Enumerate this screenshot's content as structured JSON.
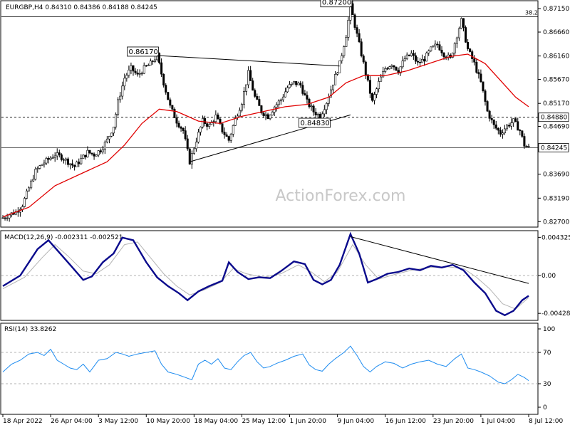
{
  "chart_data": [
    {
      "type": "candlestick",
      "title": "EURGBP,H4  0.84310 0.84386 0.84188 0.84245",
      "ylim": [
        0.826,
        0.873
      ],
      "y_ticks": [
        "0.87150",
        "0.86660",
        "0.86160",
        "0.85670",
        "0.85170",
        "0.84690",
        "0.84200",
        "0.83690",
        "0.83190",
        "0.82700"
      ],
      "x_ticks": [
        "18 Apr 2022",
        "26 Apr 04:00",
        "3 May 12:00",
        "10 May 20:00",
        "18 May 04:00",
        "25 May 12:00",
        "1 Jun 20:00",
        "9 Jun 04:00",
        "16 Jun 12:00",
        "23 Jun 20:00",
        "1 Jul 04:00",
        "8 Jul 12:00"
      ],
      "fib_level": {
        "label": "38.2",
        "value": 0.8698
      },
      "support_level": {
        "label": "0.84880",
        "value": 0.8488
      },
      "current_price": {
        "label": "0.84245",
        "value": 0.84245
      },
      "annotations": [
        {
          "text": "0.87200",
          "value": 0.872
        },
        {
          "text": "0.86170",
          "value": 0.8617
        },
        {
          "text": "0.84830",
          "value": 0.8483
        }
      ],
      "price_path": [
        [
          0,
          0.8278
        ],
        [
          3,
          0.8285
        ],
        [
          6,
          0.829
        ],
        [
          9,
          0.8305
        ],
        [
          12,
          0.834
        ],
        [
          15,
          0.8375
        ],
        [
          18,
          0.839
        ],
        [
          21,
          0.84
        ],
        [
          24,
          0.841
        ],
        [
          27,
          0.8405
        ],
        [
          30,
          0.8395
        ],
        [
          33,
          0.8385
        ],
        [
          36,
          0.84
        ],
        [
          39,
          0.8415
        ],
        [
          42,
          0.841
        ],
        [
          45,
          0.842
        ],
        [
          48,
          0.844
        ],
        [
          51,
          0.847
        ],
        [
          53,
          0.852
        ],
        [
          56,
          0.857
        ],
        [
          59,
          0.859
        ],
        [
          62,
          0.8575
        ],
        [
          65,
          0.859
        ],
        [
          68,
          0.86
        ],
        [
          71,
          0.8617
        ],
        [
          74,
          0.856
        ],
        [
          77,
          0.851
        ],
        [
          80,
          0.848
        ],
        [
          83,
          0.846
        ],
        [
          86,
          0.8395
        ],
        [
          89,
          0.844
        ],
        [
          92,
          0.848
        ],
        [
          95,
          0.847
        ],
        [
          98,
          0.849
        ],
        [
          101,
          0.846
        ],
        [
          104,
          0.844
        ],
        [
          107,
          0.8485
        ],
        [
          110,
          0.852
        ],
        [
          113,
          0.858
        ],
        [
          116,
          0.853
        ],
        [
          119,
          0.85
        ],
        [
          122,
          0.849
        ],
        [
          125,
          0.851
        ],
        [
          128,
          0.8525
        ],
        [
          131,
          0.855
        ],
        [
          134,
          0.856
        ],
        [
          137,
          0.8555
        ],
        [
          140,
          0.852
        ],
        [
          143,
          0.85
        ],
        [
          146,
          0.849
        ],
        [
          149,
          0.852
        ],
        [
          152,
          0.856
        ],
        [
          155,
          0.86
        ],
        [
          158,
          0.866
        ],
        [
          160,
          0.872
        ],
        [
          162,
          0.868
        ],
        [
          165,
          0.862
        ],
        [
          168,
          0.856
        ],
        [
          170,
          0.852
        ],
        [
          173,
          0.856
        ],
        [
          176,
          0.859
        ],
        [
          179,
          0.86
        ],
        [
          182,
          0.8585
        ],
        [
          185,
          0.861
        ],
        [
          188,
          0.862
        ],
        [
          191,
          0.86
        ],
        [
          194,
          0.861
        ],
        [
          197,
          0.863
        ],
        [
          200,
          0.864
        ],
        [
          203,
          0.862
        ],
        [
          206,
          0.861
        ],
        [
          209,
          0.866
        ],
        [
          211,
          0.869
        ],
        [
          214,
          0.863
        ],
        [
          217,
          0.86
        ],
        [
          220,
          0.856
        ],
        [
          223,
          0.85
        ],
        [
          226,
          0.847
        ],
        [
          229,
          0.8455
        ],
        [
          232,
          0.847
        ],
        [
          235,
          0.848
        ],
        [
          238,
          0.846
        ],
        [
          240,
          0.843
        ],
        [
          242,
          0.84245
        ]
      ],
      "ma_path": [
        [
          0,
          0.828
        ],
        [
          12,
          0.83
        ],
        [
          24,
          0.8345
        ],
        [
          36,
          0.837
        ],
        [
          48,
          0.8395
        ],
        [
          56,
          0.843
        ],
        [
          64,
          0.8475
        ],
        [
          72,
          0.8505
        ],
        [
          80,
          0.85
        ],
        [
          90,
          0.848
        ],
        [
          100,
          0.8475
        ],
        [
          110,
          0.849
        ],
        [
          120,
          0.85
        ],
        [
          130,
          0.851
        ],
        [
          140,
          0.8515
        ],
        [
          150,
          0.853
        ],
        [
          158,
          0.856
        ],
        [
          166,
          0.8575
        ],
        [
          176,
          0.8575
        ],
        [
          186,
          0.8585
        ],
        [
          196,
          0.86
        ],
        [
          206,
          0.8615
        ],
        [
          214,
          0.862
        ],
        [
          222,
          0.86
        ],
        [
          230,
          0.856
        ],
        [
          236,
          0.853
        ],
        [
          242,
          0.851
        ]
      ],
      "upper_trendline": [
        [
          71,
          0.8617
        ],
        [
          155,
          0.8595
        ]
      ],
      "lower_trendline": [
        [
          86,
          0.8395
        ],
        [
          160,
          0.8493
        ]
      ]
    },
    {
      "type": "line",
      "title": "MACD(12,26,9) -0.002311 -0.002521",
      "ylim": [
        -0.005,
        0.005
      ],
      "y_ticks": [
        "0.004325",
        "0.00",
        "-0.004288"
      ],
      "macd": [
        [
          0,
          -0.0012
        ],
        [
          8,
          0.0
        ],
        [
          16,
          0.003
        ],
        [
          21,
          0.004
        ],
        [
          26,
          0.0026
        ],
        [
          31,
          0.0012
        ],
        [
          37,
          -0.0005
        ],
        [
          41,
          -0.0001
        ],
        [
          46,
          0.0015
        ],
        [
          51,
          0.0025
        ],
        [
          55,
          0.0043
        ],
        [
          60,
          0.004
        ],
        [
          66,
          0.0015
        ],
        [
          71,
          -0.0002
        ],
        [
          76,
          -0.0012
        ],
        [
          81,
          -0.002
        ],
        [
          85,
          -0.0028
        ],
        [
          90,
          -0.0018
        ],
        [
          95,
          -0.0012
        ],
        [
          101,
          -0.0006
        ],
        [
          104,
          0.0015
        ],
        [
          108,
          0.0004
        ],
        [
          113,
          -0.0004
        ],
        [
          118,
          -0.0002
        ],
        [
          123,
          -0.0003
        ],
        [
          128,
          0.0005
        ],
        [
          134,
          0.0016
        ],
        [
          139,
          0.0013
        ],
        [
          143,
          -0.0005
        ],
        [
          147,
          -0.001
        ],
        [
          151,
          -0.0005
        ],
        [
          155,
          0.0012
        ],
        [
          160,
          0.0047
        ],
        [
          164,
          0.0025
        ],
        [
          168,
          -0.0008
        ],
        [
          172,
          -0.0004
        ],
        [
          177,
          0.0002
        ],
        [
          182,
          0.0004
        ],
        [
          187,
          0.0008
        ],
        [
          192,
          0.0006
        ],
        [
          197,
          0.0011
        ],
        [
          202,
          0.0009
        ],
        [
          207,
          0.0012
        ],
        [
          212,
          0.0006
        ],
        [
          217,
          -0.0008
        ],
        [
          222,
          -0.002
        ],
        [
          227,
          -0.004
        ],
        [
          231,
          -0.0045
        ],
        [
          235,
          -0.004
        ],
        [
          239,
          -0.0028
        ],
        [
          242,
          -0.0023
        ]
      ],
      "signal": [
        [
          0,
          -0.0015
        ],
        [
          10,
          -0.0002
        ],
        [
          18,
          0.002
        ],
        [
          24,
          0.0035
        ],
        [
          30,
          0.0022
        ],
        [
          37,
          0.0005
        ],
        [
          43,
          0.0002
        ],
        [
          49,
          0.0012
        ],
        [
          56,
          0.0035
        ],
        [
          62,
          0.0038
        ],
        [
          68,
          0.002
        ],
        [
          74,
          0.0002
        ],
        [
          80,
          -0.0012
        ],
        [
          86,
          -0.0022
        ],
        [
          93,
          -0.0016
        ],
        [
          100,
          -0.0008
        ],
        [
          106,
          0.0008
        ],
        [
          112,
          0.0002
        ],
        [
          120,
          -0.0002
        ],
        [
          128,
          0.0002
        ],
        [
          136,
          0.0012
        ],
        [
          142,
          0.0004
        ],
        [
          148,
          -0.0007
        ],
        [
          154,
          0.0004
        ],
        [
          161,
          0.0035
        ],
        [
          167,
          0.0012
        ],
        [
          173,
          -0.0004
        ],
        [
          180,
          0.0001
        ],
        [
          188,
          0.0006
        ],
        [
          196,
          0.0009
        ],
        [
          204,
          0.001
        ],
        [
          212,
          0.0008
        ],
        [
          218,
          -0.0002
        ],
        [
          224,
          -0.0015
        ],
        [
          230,
          -0.0032
        ],
        [
          236,
          -0.0038
        ],
        [
          242,
          -0.0025
        ]
      ],
      "trendline": [
        [
          160,
          0.0044
        ],
        [
          242,
          -0.0009
        ]
      ]
    },
    {
      "type": "line",
      "title": "RSI(14) 33.8262",
      "ylim": [
        0,
        100
      ],
      "y_ticks": [
        "100",
        "70",
        "30",
        "0"
      ],
      "levels": [
        70,
        30
      ],
      "rsi": [
        [
          0,
          45
        ],
        [
          4,
          55
        ],
        [
          8,
          60
        ],
        [
          12,
          68
        ],
        [
          16,
          70
        ],
        [
          19,
          66
        ],
        [
          22,
          74
        ],
        [
          25,
          60
        ],
        [
          28,
          55
        ],
        [
          31,
          50
        ],
        [
          34,
          48
        ],
        [
          37,
          55
        ],
        [
          40,
          45
        ],
        [
          44,
          60
        ],
        [
          48,
          62
        ],
        [
          52,
          70
        ],
        [
          55,
          68
        ],
        [
          58,
          65
        ],
        [
          62,
          68
        ],
        [
          66,
          70
        ],
        [
          70,
          72
        ],
        [
          73,
          55
        ],
        [
          76,
          45
        ],
        [
          80,
          42
        ],
        [
          84,
          38
        ],
        [
          87,
          35
        ],
        [
          90,
          55
        ],
        [
          93,
          60
        ],
        [
          96,
          55
        ],
        [
          99,
          62
        ],
        [
          102,
          50
        ],
        [
          105,
          48
        ],
        [
          108,
          58
        ],
        [
          111,
          66
        ],
        [
          114,
          70
        ],
        [
          117,
          58
        ],
        [
          120,
          50
        ],
        [
          123,
          52
        ],
        [
          126,
          56
        ],
        [
          130,
          60
        ],
        [
          134,
          65
        ],
        [
          138,
          68
        ],
        [
          141,
          54
        ],
        [
          144,
          48
        ],
        [
          147,
          46
        ],
        [
          150,
          55
        ],
        [
          153,
          62
        ],
        [
          157,
          70
        ],
        [
          160,
          78
        ],
        [
          163,
          66
        ],
        [
          166,
          52
        ],
        [
          169,
          45
        ],
        [
          172,
          52
        ],
        [
          176,
          58
        ],
        [
          180,
          56
        ],
        [
          184,
          50
        ],
        [
          188,
          55
        ],
        [
          192,
          58
        ],
        [
          196,
          60
        ],
        [
          200,
          55
        ],
        [
          204,
          52
        ],
        [
          208,
          62
        ],
        [
          211,
          68
        ],
        [
          214,
          50
        ],
        [
          217,
          48
        ],
        [
          220,
          45
        ],
        [
          224,
          40
        ],
        [
          228,
          32
        ],
        [
          231,
          30
        ],
        [
          234,
          35
        ],
        [
          237,
          42
        ],
        [
          240,
          38
        ],
        [
          242,
          34
        ]
      ]
    }
  ],
  "watermark": "ActionForex.com"
}
